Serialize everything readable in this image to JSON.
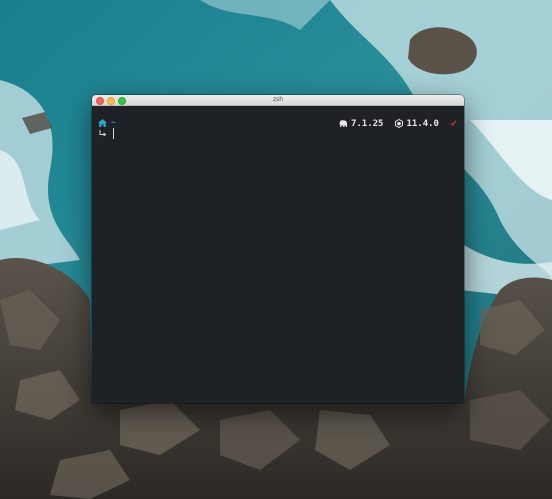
{
  "window": {
    "title": "zsh"
  },
  "prompt": {
    "icon_home": "home-icon",
    "cwd": "~",
    "icon_continuation": "return-arrow-icon",
    "right": {
      "elephant_icon": "elephant-icon",
      "version_a": "7.1.25",
      "node_icon": "hexagon-icon",
      "version_b": "11.4.0",
      "status_icon": "check-icon",
      "status_symbol": "✔"
    }
  },
  "colors": {
    "terminal_bg": "#1e2125",
    "accent": "#2aa8c9",
    "status_ok": "#e0312d",
    "titlebar": "#e5e5e5"
  }
}
